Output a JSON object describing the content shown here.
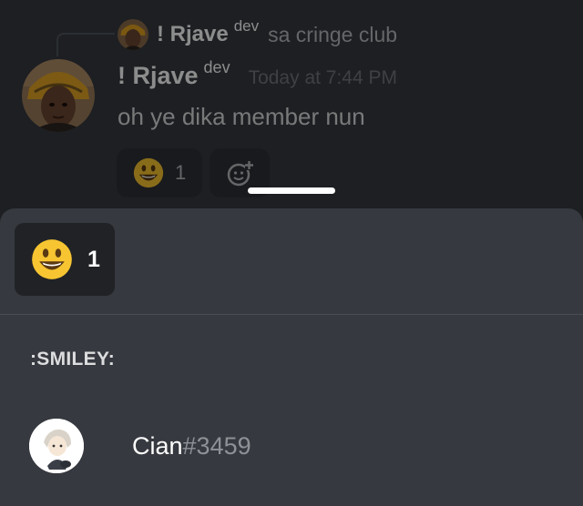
{
  "reply": {
    "username": "! Rjave",
    "role_tag": "dev",
    "content": "sa cringe club"
  },
  "message": {
    "username": "! Rjave",
    "role_tag": "dev",
    "timestamp": "Today at 7:44 PM",
    "content": "oh ye dika member nun",
    "reaction": {
      "emoji": "smiley-emoji",
      "count": "1"
    },
    "add_reaction_icon": "add-reaction-icon"
  },
  "sheet": {
    "tab": {
      "emoji": "smiley-emoji",
      "count": "1"
    },
    "section_title": ":SMILEY:",
    "users": [
      {
        "name": "Cian",
        "discriminator": "#3459"
      }
    ]
  },
  "colors": {
    "background": "#36393f",
    "sheet_tab": "#202225",
    "muted_text": "#8e9297"
  }
}
